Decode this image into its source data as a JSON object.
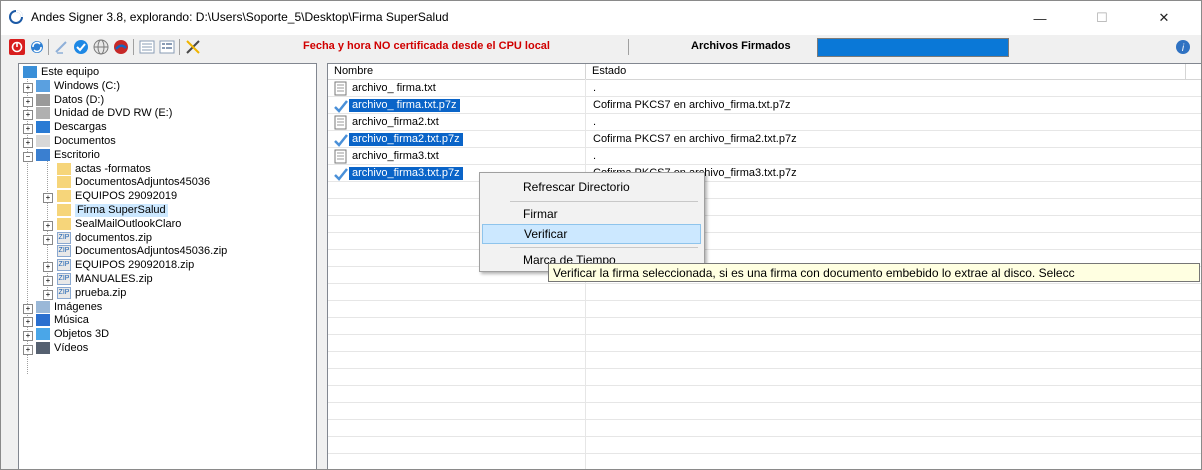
{
  "window": {
    "title": "Andes Signer 3.8, explorando: D:\\Users\\Soporte_5\\Desktop\\Firma SuperSalud",
    "minimize": "—",
    "maximize": "☐",
    "close": "✕"
  },
  "toolbar": {
    "cert_warning": "Fecha y hora NO certificada desde el CPU local",
    "archivos_label": "Archivos Firmados",
    "accent": "#0a78d7",
    "warning_color": "#d00000"
  },
  "tree": {
    "items": [
      {
        "label": "Este equipo",
        "icon": "computer-icon"
      },
      {
        "label": "Windows (C:)",
        "icon": "drive-windows-icon"
      },
      {
        "label": "Datos (D:)",
        "icon": "drive-icon"
      },
      {
        "label": "Unidad de DVD RW (E:)",
        "icon": "dvd-icon"
      },
      {
        "label": "Descargas",
        "icon": "download-folder-icon"
      },
      {
        "label": "Documentos",
        "icon": "documents-folder-icon"
      },
      {
        "label": "Escritorio",
        "icon": "desktop-folder-icon"
      },
      {
        "label": "actas -formatos",
        "icon": "folder-icon"
      },
      {
        "label": "DocumentosAdjuntos45036",
        "icon": "folder-icon"
      },
      {
        "label": "EQUIPOS 29092019",
        "icon": "folder-icon"
      },
      {
        "label": "Firma SuperSalud",
        "icon": "folder-icon"
      },
      {
        "label": "SealMailOutlookClaro",
        "icon": "folder-icon"
      },
      {
        "label": "documentos.zip",
        "icon": "zip-icon"
      },
      {
        "label": "DocumentosAdjuntos45036.zip",
        "icon": "zip-icon"
      },
      {
        "label": "EQUIPOS 29092018.zip",
        "icon": "zip-icon"
      },
      {
        "label": "MANUALES.zip",
        "icon": "zip-icon"
      },
      {
        "label": "prueba.zip",
        "icon": "zip-icon"
      },
      {
        "label": "Imágenes",
        "icon": "pictures-folder-icon"
      },
      {
        "label": "Música",
        "icon": "music-folder-icon"
      },
      {
        "label": "Objetos 3D",
        "icon": "objects3d-folder-icon"
      },
      {
        "label": "Vídeos",
        "icon": "videos-folder-icon"
      }
    ]
  },
  "list": {
    "columns": [
      "Nombre",
      "Estado"
    ],
    "rows": [
      {
        "name": "archivo_ firma.txt",
        "state": ".",
        "selected": false
      },
      {
        "name": "archivo_ firma.txt.p7z",
        "state": "Cofirma PKCS7 en archivo_firma.txt.p7z",
        "selected": true
      },
      {
        "name": "archivo_firma2.txt",
        "state": ".",
        "selected": false
      },
      {
        "name": "archivo_firma2.txt.p7z",
        "state": "Cofirma PKCS7 en archivo_firma2.txt.p7z",
        "selected": true
      },
      {
        "name": "archivo_firma3.txt",
        "state": ".",
        "selected": false
      },
      {
        "name": "archivo_firma3.txt.p7z",
        "state": "Cofirma PKCS7 en archivo_firma3.txt.p7z",
        "selected": true
      }
    ]
  },
  "context_menu": {
    "refrescar": "Refrescar Directorio",
    "firmar": "Firmar",
    "verificar": "Verificar",
    "marca": "Marca de Tiempo"
  },
  "tooltip": "Verificar la firma seleccionada, si es una firma con documento embebido lo extrae al disco. Selecc"
}
